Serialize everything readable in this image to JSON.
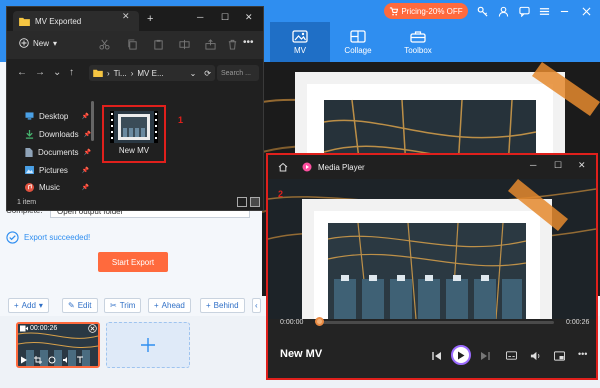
{
  "app": {
    "pricing_label": "Pricing-20% OFF",
    "tabs": [
      {
        "label": "MV"
      },
      {
        "label": "Collage"
      },
      {
        "label": "Toolbox"
      }
    ],
    "complete_label": "Complete:",
    "complete_value": "Open output folder",
    "export_status": "Export succeeded!",
    "start_export": "Start Export",
    "toolbar": {
      "add": "Add",
      "edit": "Edit",
      "trim": "Trim",
      "ahead": "Ahead",
      "behind": "Behind"
    },
    "clip_duration": "00:00:26",
    "accent": "#2f8ef0",
    "orange": "#ff6a3d"
  },
  "explorer": {
    "tab_title": "MV Exported",
    "new_label": "New",
    "address": [
      "Ti...",
      "MV E..."
    ],
    "search_placeholder": "Search ...",
    "nav_items": [
      {
        "label": "Desktop",
        "icon": "desktop-icon",
        "color": "#4aa0e6"
      },
      {
        "label": "Downloads",
        "icon": "download-icon",
        "color": "#46b46e"
      },
      {
        "label": "Documents",
        "icon": "document-icon",
        "color": "#8fa3b8"
      },
      {
        "label": "Pictures",
        "icon": "picture-icon",
        "color": "#4aa0e6"
      },
      {
        "label": "Music",
        "icon": "music-icon",
        "color": "#e0523f"
      }
    ],
    "file_name": "New MV",
    "status": "1 item",
    "annotation": "1"
  },
  "player": {
    "title": "Media Player",
    "current_time": "0:00:00",
    "total_time": "0:00:26",
    "progress": 0,
    "video_title": "New MV",
    "annotation": "2"
  }
}
